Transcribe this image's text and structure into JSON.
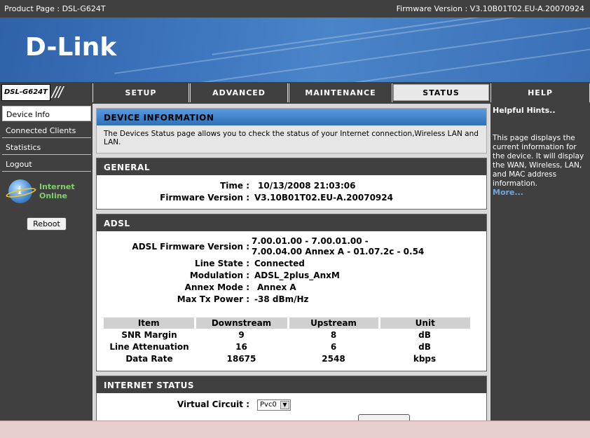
{
  "topbar": {
    "product": "Product Page : DSL-G624T",
    "firmware": "Firmware Version :  V3.10B01T02.EU-A.20070924"
  },
  "banner": {
    "logo": "D-Link"
  },
  "nav": {
    "model": "DSL-G624T",
    "slashes": "///",
    "tabs": [
      "SETUP",
      "ADVANCED",
      "MAINTENANCE",
      "STATUS",
      "HELP"
    ],
    "active_tab": "STATUS"
  },
  "sidebar": {
    "items": [
      {
        "label": "Device Info"
      },
      {
        "label": "Connected Clients"
      },
      {
        "label": "Statistics"
      },
      {
        "label": "Logout"
      }
    ],
    "online_line1": "Internet",
    "online_line2": "Online",
    "reboot_label": "Reboot"
  },
  "device_info": {
    "title": "DEVICE INFORMATION",
    "description": "The Devices Status page allows you to check the status of your Internet connection,Wireless LAN and LAN."
  },
  "general": {
    "title": "GENERAL",
    "time_label": "Time :",
    "time_value": "10/13/2008 21:03:06",
    "firmware_label": "Firmware Version :",
    "firmware_value": "V3.10B01T02.EU-A.20070924"
  },
  "adsl": {
    "title": "ADSL",
    "firmware_label": "ADSL Firmware Version :",
    "firmware_value_line1": "7.00.01.00 - 7.00.01.00 -",
    "firmware_value_line2": "7.00.04.00 Annex A - 01.07.2c - 0.54",
    "line_state_label": "Line State :",
    "line_state_value": "Connected",
    "modulation_label": "Modulation :",
    "modulation_value": "ADSL_2plus_AnxM",
    "annex_label": "Annex Mode :",
    "annex_value": "Annex A",
    "maxtx_label": "Max Tx Power :",
    "maxtx_value": "-38 dBm/Hz",
    "table": {
      "headers": [
        "Item",
        "Downstream",
        "Upstream",
        "Unit"
      ],
      "rows": [
        [
          "SNR Margin",
          "9",
          "8",
          "dB"
        ],
        [
          "Line Attenuation",
          "16",
          "6",
          "dB"
        ],
        [
          "Data Rate",
          "18675",
          "2548",
          "kbps"
        ]
      ]
    }
  },
  "internet_status": {
    "title": "INTERNET STATUS",
    "vc_label": "Virtual Circuit :",
    "vc_value": "Pvc0"
  },
  "help": {
    "title": "Helpful Hints..",
    "text": "This page displays the current information for the device. It will display the WAN, Wireless, LAN, and MAC address information.",
    "more": "More..."
  }
}
